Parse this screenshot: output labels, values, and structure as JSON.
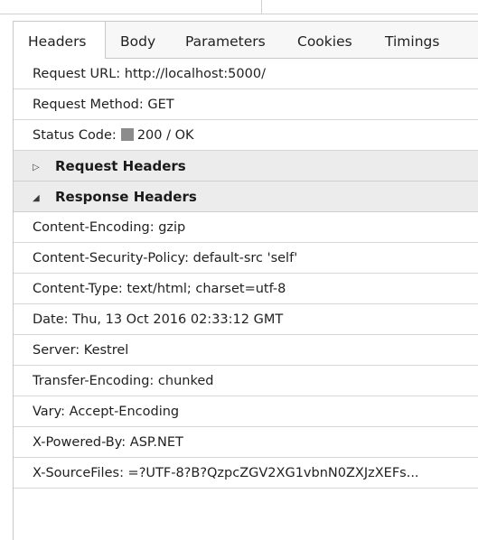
{
  "tabs": [
    {
      "label": "Headers",
      "active": true
    },
    {
      "label": "Body",
      "active": false
    },
    {
      "label": "Parameters",
      "active": false
    },
    {
      "label": "Cookies",
      "active": false
    },
    {
      "label": "Timings",
      "active": false
    }
  ],
  "general": {
    "request_url": "Request URL: http://localhost:5000/",
    "request_method": "Request Method: GET",
    "status_label": "Status Code:",
    "status_value": "200 / OK",
    "status_color": "#8c8c8c"
  },
  "sections": {
    "request_headers": {
      "label": "Request Headers",
      "expanded": false,
      "arrow": "▷"
    },
    "response_headers": {
      "label": "Response Headers",
      "expanded": true,
      "arrow": "◢"
    }
  },
  "response_headers": [
    "Content-Encoding: gzip",
    "Content-Security-Policy: default-src 'self'",
    "Content-Type: text/html; charset=utf-8",
    "Date: Thu, 13 Oct 2016 02:33:12 GMT",
    "Server: Kestrel",
    "Transfer-Encoding: chunked",
    "Vary: Accept-Encoding",
    "X-Powered-By: ASP.NET",
    "X-SourceFiles: =?UTF-8?B?QzpcZGV2XG1vbnN0ZXJzXEFs..."
  ]
}
